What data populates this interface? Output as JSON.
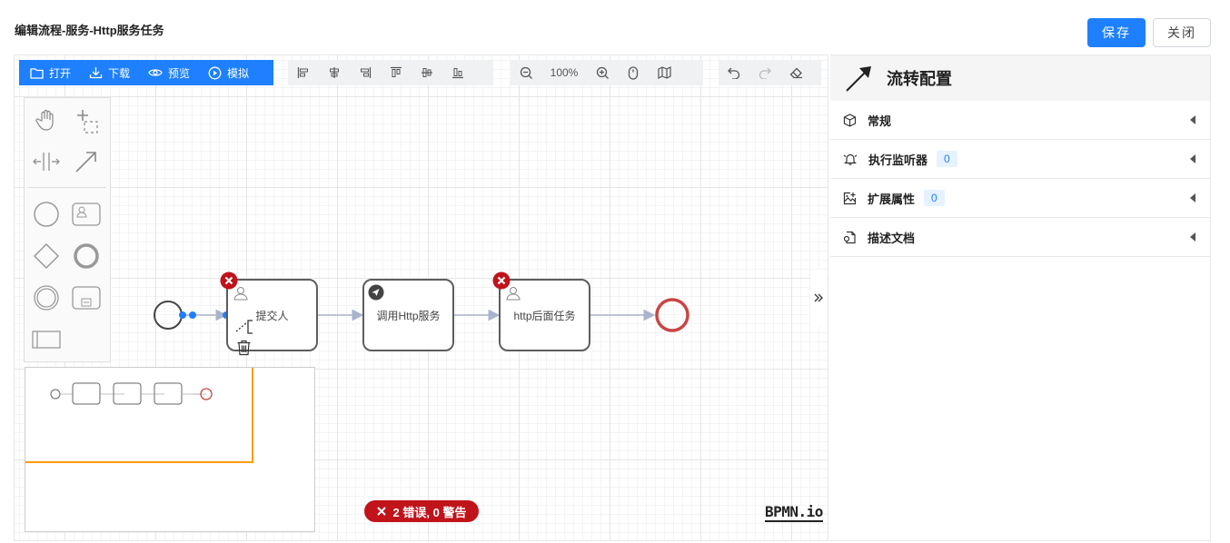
{
  "header": {
    "title": "编辑流程-服务-Http服务任务",
    "save_label": "保存",
    "close_label": "关闭"
  },
  "toolbar": {
    "open_label": "打开",
    "download_label": "下载",
    "preview_label": "预览",
    "simulate_label": "模拟",
    "zoom": "100%"
  },
  "diagram": {
    "tasks": [
      {
        "label": "提交人"
      },
      {
        "label": "调用Http服务"
      },
      {
        "label": "http后面任务"
      }
    ]
  },
  "validation": {
    "text": "2 错误, 0 警告"
  },
  "brand": {
    "logo": "BPMN.io"
  },
  "panel": {
    "title": "流转配置",
    "sections": [
      {
        "label": "常规",
        "icon": "cube-icon"
      },
      {
        "label": "执行监听器",
        "icon": "bell-icon",
        "count": "0"
      },
      {
        "label": "扩展属性",
        "icon": "image-plus-icon",
        "count": "0"
      },
      {
        "label": "描述文档",
        "icon": "doc-icon"
      }
    ]
  },
  "colors": {
    "primary": "#1e80ff",
    "error": "#c0131a",
    "end_event": "#c94545",
    "minimap_viewport": "#ff9c00"
  }
}
